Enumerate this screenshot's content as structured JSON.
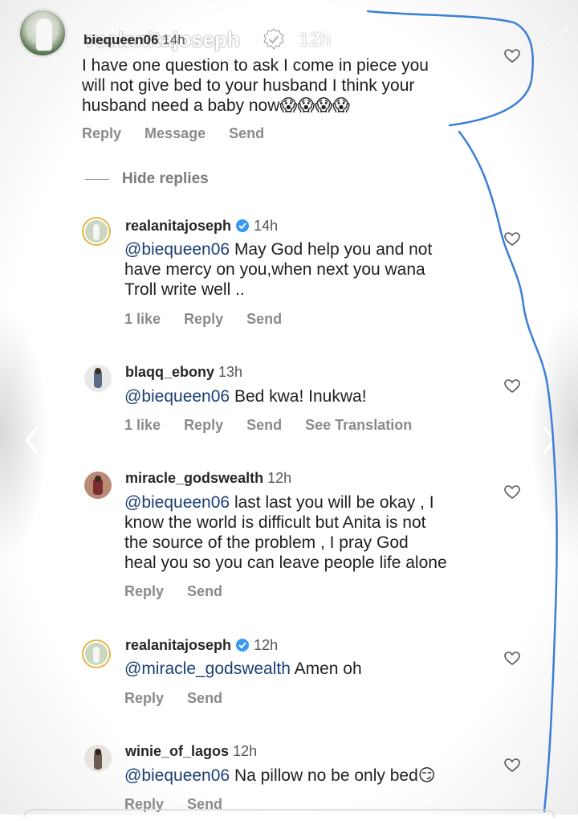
{
  "story": {
    "username": "realanitajoseph",
    "time": "12h"
  },
  "parent_comment": {
    "username": "biequeen06",
    "time": "14h",
    "text_lines": [
      "I have one question to ask I come in piece you",
      "will not give bed to your husband I think your",
      "husband need a baby now😱😱😱😱"
    ],
    "actions": [
      "Reply",
      "Message",
      "Send"
    ]
  },
  "hide_replies": "Hide replies",
  "replies": [
    {
      "username": "realanitajoseph",
      "verified": true,
      "time": "14h",
      "mention": "@biequeen06",
      "text_lines": [
        " May God help you and not",
        "have mercy on you,when next you wana",
        "Troll write well .."
      ],
      "actions": [
        "1 like",
        "Reply",
        "Send"
      ]
    },
    {
      "username": "blaqq_ebony",
      "verified": false,
      "time": "13h",
      "mention": "@biequeen06",
      "text_lines": [
        " Bed kwa! Inukwa!"
      ],
      "actions": [
        "1 like",
        "Reply",
        "Send",
        "See Translation"
      ]
    },
    {
      "username": "miracle_godswealth",
      "verified": false,
      "time": "12h",
      "mention": "@biequeen06",
      "text_lines": [
        " last last you will be okay , I",
        "know the world is difficult but Anita is not",
        "the source of the problem , I pray God",
        "heal you so you can leave people life alone"
      ],
      "actions": [
        "Reply",
        "Send"
      ]
    },
    {
      "username": "realanitajoseph",
      "verified": true,
      "time": "12h",
      "mention": "@miracle_godswealth",
      "text_lines": [
        " Amen oh"
      ],
      "actions": [
        "Reply",
        "Send"
      ]
    },
    {
      "username": "winie_of_lagos",
      "verified": false,
      "time": "12h",
      "mention": "@biequeen06",
      "text_lines": [
        " Na pillow no be only bed😏"
      ],
      "actions": [
        "Reply",
        "Send"
      ]
    }
  ],
  "icons": {
    "close": "close-icon",
    "heart": "heart-icon",
    "verified": "verified-badge-icon",
    "prev": "chevron-left-icon",
    "next": "chevron-right-icon"
  },
  "colors": {
    "mention": "#1b3f73",
    "verified": "#3897f0",
    "scribble": "#3b7fd6"
  }
}
